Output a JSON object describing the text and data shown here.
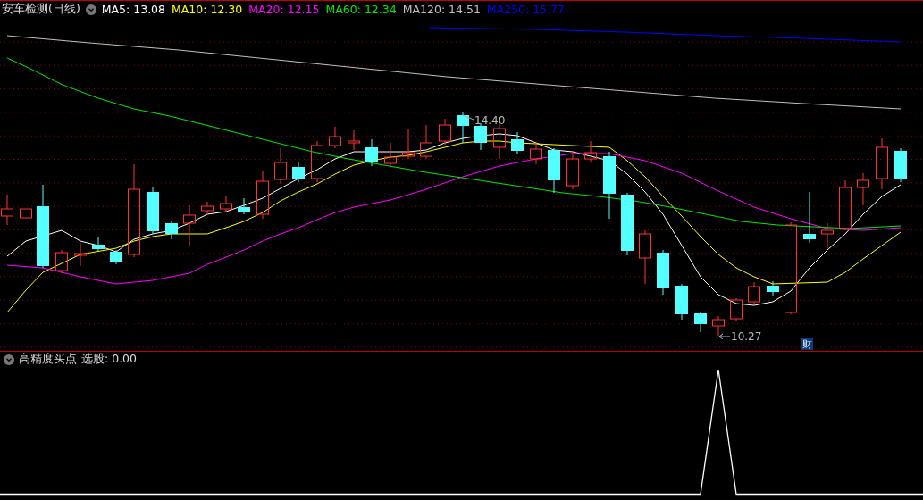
{
  "main_chart": {
    "title": "安车检测(日线)",
    "legend": [
      {
        "label": "MA5: 13.08",
        "color": "#ffffff"
      },
      {
        "label": "MA10: 12.30",
        "color": "#ffff00"
      },
      {
        "label": "MA20: 12.15",
        "color": "#ff00ff"
      },
      {
        "label": "MA60: 12.34",
        "color": "#00e600"
      },
      {
        "label": "MA120: 14.51",
        "color": "#c0c0c0"
      },
      {
        "label": "MA250: 15.77",
        "color": "#0000ff"
      }
    ],
    "high_label": "14.40",
    "low_label": "10.27",
    "badge": "财"
  },
  "indicator": {
    "title": "高精度买点",
    "reading": "选股: 0.00"
  }
}
